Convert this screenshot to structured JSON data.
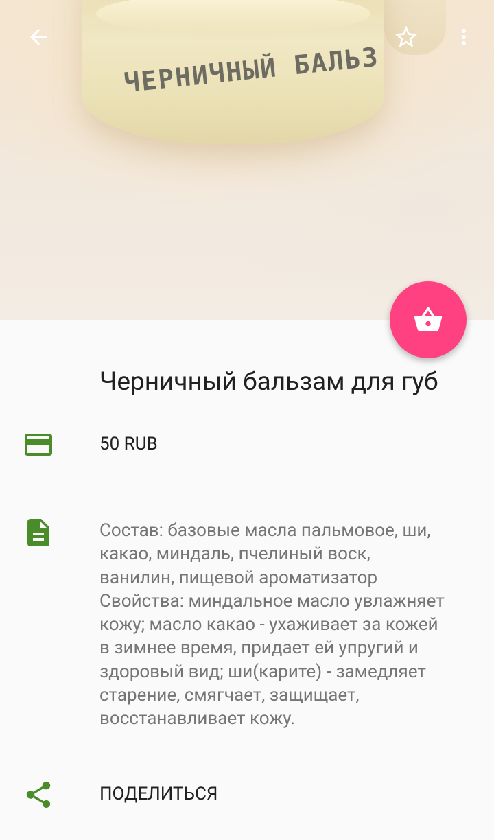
{
  "product": {
    "title": "Черничный бальзам для губ",
    "image_label_text": "ЧЕРНИЧНЫЙ БАЛЬЗ",
    "price": "50 RUB",
    "description_lines": [
      "Состав: базовые масла пальмовое, ши,",
      "какао, миндаль, пчелиный воск,",
      "ванилин, пищевой ароматизатор",
      "Свойства: миндальное масло увлажняет",
      "кожу; масло какао - ухаживает за кожей",
      "в зимнее время, придает ей упругий и",
      "здоровый вид; ши(карите) - замедляет",
      "старение, смягчает, защищает,",
      "восстанавливает кожу."
    ]
  },
  "actions": {
    "share_label": "ПОДЕЛИТЬСЯ"
  },
  "icons": {
    "back": "arrow-back-icon",
    "favorite": "star-outline-icon",
    "more": "more-vert-icon",
    "cart": "basket-icon",
    "price": "credit-card-icon",
    "description": "document-icon",
    "share": "share-icon"
  },
  "colors": {
    "accent": "#ff4081",
    "icon_green": "#4a8c2a",
    "text_primary": "#212121",
    "text_secondary": "#757575",
    "background": "#fafafa"
  }
}
